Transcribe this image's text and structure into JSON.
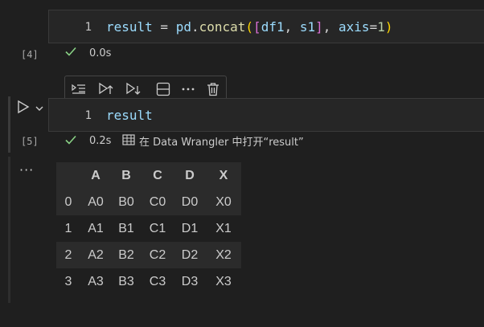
{
  "cell4": {
    "line_number": "1",
    "code_tokens": [
      {
        "text": "result",
        "cls": "tok-var"
      },
      {
        "text": " = ",
        "cls": "tok-op"
      },
      {
        "text": "pd",
        "cls": "tok-var"
      },
      {
        "text": ".",
        "cls": "tok-op"
      },
      {
        "text": "concat",
        "cls": "tok-fn"
      },
      {
        "text": "(",
        "cls": "tok-br1"
      },
      {
        "text": "[",
        "cls": "tok-br2"
      },
      {
        "text": "df1",
        "cls": "tok-var"
      },
      {
        "text": ", ",
        "cls": "tok-op"
      },
      {
        "text": "s1",
        "cls": "tok-var"
      },
      {
        "text": "]",
        "cls": "tok-br2"
      },
      {
        "text": ", ",
        "cls": "tok-op"
      },
      {
        "text": "axis",
        "cls": "tok-var"
      },
      {
        "text": "=",
        "cls": "tok-op"
      },
      {
        "text": "1",
        "cls": "tok-num"
      },
      {
        "text": ")",
        "cls": "tok-br1"
      }
    ],
    "execution_count": "[4]",
    "status_icon": "check-icon",
    "duration": "0.0s"
  },
  "toolbar": {
    "icons": [
      "run-by-line-icon",
      "execute-above-icon",
      "execute-below-icon",
      "split-cell-icon",
      "more-actions-icon",
      "delete-cell-icon"
    ]
  },
  "cell5": {
    "line_number": "1",
    "code": "result",
    "execution_count": "[5]",
    "status_icon": "check-icon",
    "duration": "0.2s",
    "data_wrangler_link": "在 Data Wrangler 中打开“result”"
  },
  "output": {
    "more_label": "···",
    "table": {
      "columns": [
        "",
        "A",
        "B",
        "C",
        "D",
        "X"
      ],
      "rows": [
        [
          "0",
          "A0",
          "B0",
          "C0",
          "D0",
          "X0"
        ],
        [
          "1",
          "A1",
          "B1",
          "C1",
          "D1",
          "X1"
        ],
        [
          "2",
          "A2",
          "B2",
          "C2",
          "D2",
          "X2"
        ],
        [
          "3",
          "A3",
          "B3",
          "C3",
          "D3",
          "X3"
        ]
      ]
    }
  },
  "colors": {
    "background": "#1f1f1f",
    "cell_background": "#262626",
    "success_green": "#89d185"
  }
}
